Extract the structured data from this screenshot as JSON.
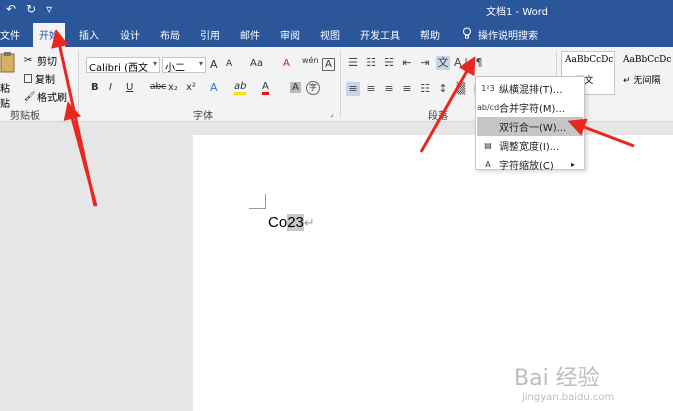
{
  "app": {
    "doc_title": "文档1 - Word",
    "qat": [
      "↶",
      "↻",
      "▿"
    ]
  },
  "tabs": [
    "文件",
    "开始",
    "插入",
    "设计",
    "布局",
    "引用",
    "邮件",
    "审阅",
    "视图",
    "开发工具",
    "帮助"
  ],
  "tell_me": {
    "icon": "lightbulb-icon",
    "label": "操作说明搜索"
  },
  "clipboard": {
    "paste_label": "粘贴",
    "cut": "剪切",
    "copy": "复制",
    "format_painter": "格式刷",
    "group_label": "剪贴板"
  },
  "font": {
    "font_name": "Calibri (西文",
    "font_size": "小二",
    "grow": "A",
    "shrink": "A",
    "case": "Aa",
    "clear": "A",
    "phonetic": "wén",
    "border": "A",
    "bold": "B",
    "italic": "I",
    "underline": "U",
    "strike": "abc",
    "sub": "x₂",
    "sup": "x²",
    "effects": "A",
    "highlight": "ab",
    "color": "A",
    "size_a": "A",
    "circle": "字",
    "group_label": "字体",
    "highlight_color": "#f5e600",
    "font_color": "#e81123"
  },
  "paragraph": {
    "group_label": "段落",
    "row1": [
      "☰",
      "☷",
      "☵",
      "⇤",
      "⇥",
      "文",
      "A↓",
      "¶"
    ],
    "row2": [
      "≡",
      "≡",
      "≡",
      "≡",
      "☷",
      "↕",
      "▒",
      "▦"
    ]
  },
  "styles": [
    {
      "preview": "AaBbCcDc",
      "name": "↵ 正文"
    },
    {
      "preview": "AaBbCcDc",
      "name": "↵ 无间隔"
    }
  ],
  "menu": {
    "items": [
      {
        "icon": "1²3",
        "label": "纵横混排(T)..."
      },
      {
        "icon": "ab/cd",
        "label": "合并字符(M)..."
      },
      {
        "icon": "",
        "label": "双行合一(W)..."
      },
      {
        "icon": "▤",
        "label": "调整宽度(I)..."
      },
      {
        "icon": "A",
        "label": "字符缩放(C)",
        "arrow": "▸"
      }
    ],
    "highlighted_index": 2
  },
  "document": {
    "text_plain": "Co",
    "text_highlighted": "23",
    "para_mark": "↵"
  },
  "watermark": {
    "main": "Bai 经验",
    "sub": "jingyan.baidu.com"
  },
  "colors": {
    "accent": "#2b579a",
    "arrow": "#e8271f"
  }
}
